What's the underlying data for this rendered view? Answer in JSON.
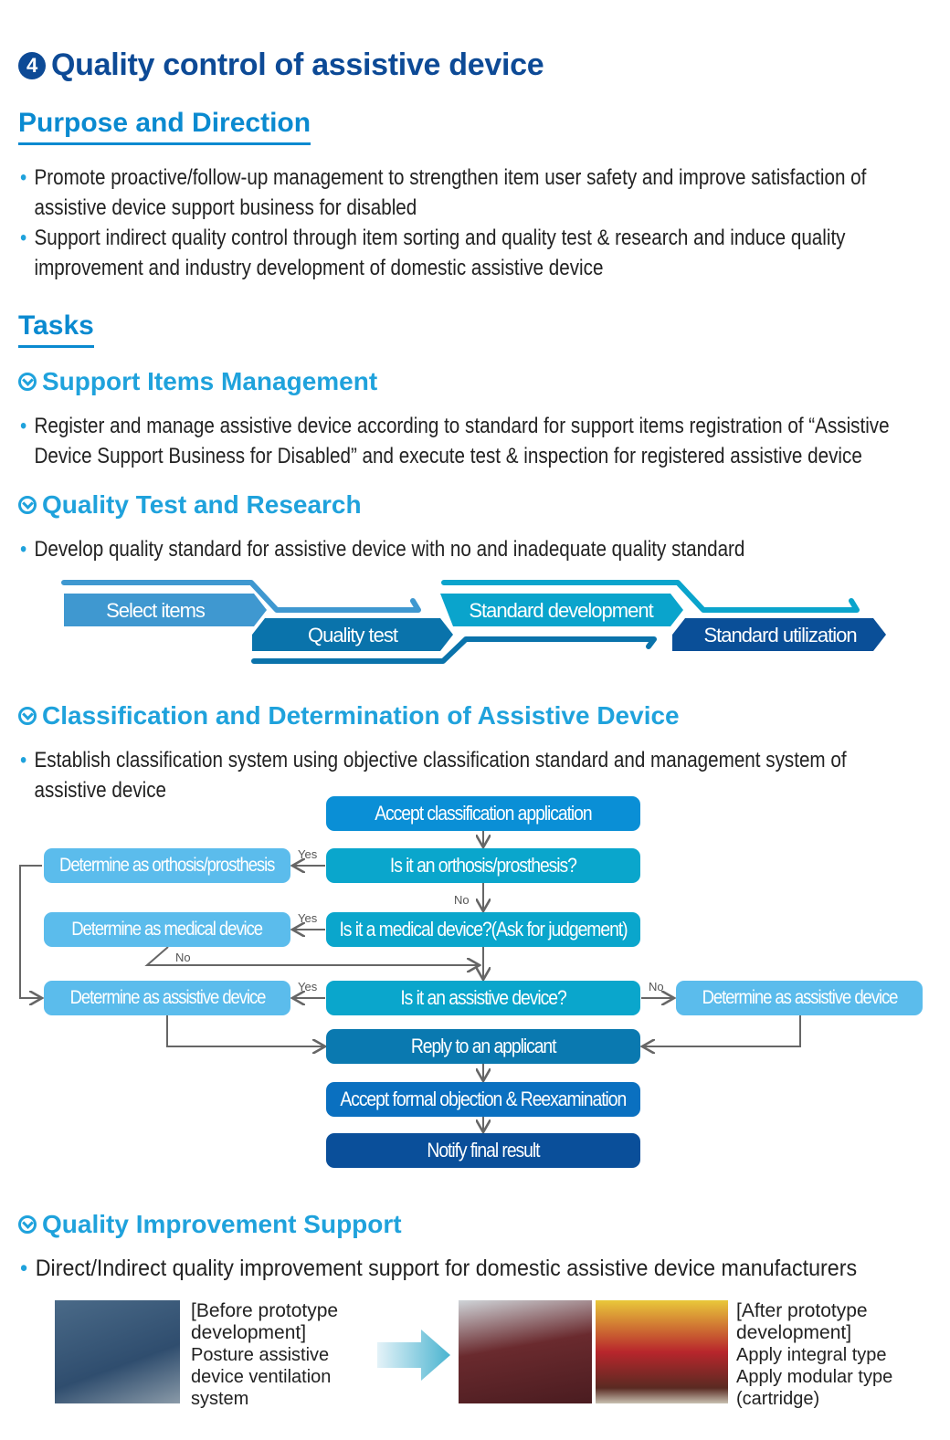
{
  "title": {
    "number": "4",
    "text": "Quality control of assistive device"
  },
  "purpose": {
    "heading": "Purpose and Direction",
    "bullets": [
      "Promote proactive/follow-up management to strengthen item user safety and improve satisfaction of assistive device support business for disabled",
      "Support indirect quality control through item sorting and quality test & research and induce quality improvement and industry development of domestic assistive device"
    ]
  },
  "tasks": {
    "heading": "Tasks"
  },
  "support_items": {
    "heading": "Support Items Management",
    "bullets": [
      "Register and manage assistive device according to standard for support items registration of “Assistive Device Support Business for Disabled” and execute test & inspection for registered assistive device"
    ]
  },
  "quality_test": {
    "heading": "Quality Test and Research",
    "bullets": [
      "Develop quality standard for assistive device with no and inadequate quality standard"
    ],
    "process": [
      {
        "label": "Select items",
        "color": "#3f98d0"
      },
      {
        "label": "Quality test",
        "color": "#0a73ab"
      },
      {
        "label": "Standard development",
        "color": "#0aa4cc"
      },
      {
        "label": "Standard utilization",
        "color": "#0a4f98"
      }
    ]
  },
  "classification": {
    "heading": "Classification and Determination of Assistive Device",
    "bullets": [
      "Establish classification system using objective classification standard and management system of assistive device"
    ],
    "flow": {
      "accept": "Accept classification application",
      "q_orthosis": "Is it an orthosis/prosthesis?",
      "q_medical": "Is it a medical device?(Ask for judgement)",
      "q_assistive": "Is it an assistive device?",
      "d_orthosis": "Determine as orthosis/prosthesis",
      "d_medical": "Determine as medical device",
      "d_assistive_left": "Determine as assistive device",
      "d_assistive_right": "Determine as assistive device",
      "reply": "Reply to an applicant",
      "objection": "Accept formal objection & Reexamination",
      "notify": "Notify final result",
      "yes": "Yes",
      "no": "No"
    }
  },
  "improvement": {
    "heading": "Quality Improvement Support",
    "bullets": [
      "Direct/Indirect quality improvement support for domestic assistive device manufacturers"
    ],
    "before": {
      "title": "[Before prototype development]",
      "desc": "Posture assistive device ventilation system"
    },
    "after": {
      "title": "[After prototype development]",
      "lines": [
        "Apply integral type",
        "Apply modular type (cartridge)"
      ]
    }
  }
}
